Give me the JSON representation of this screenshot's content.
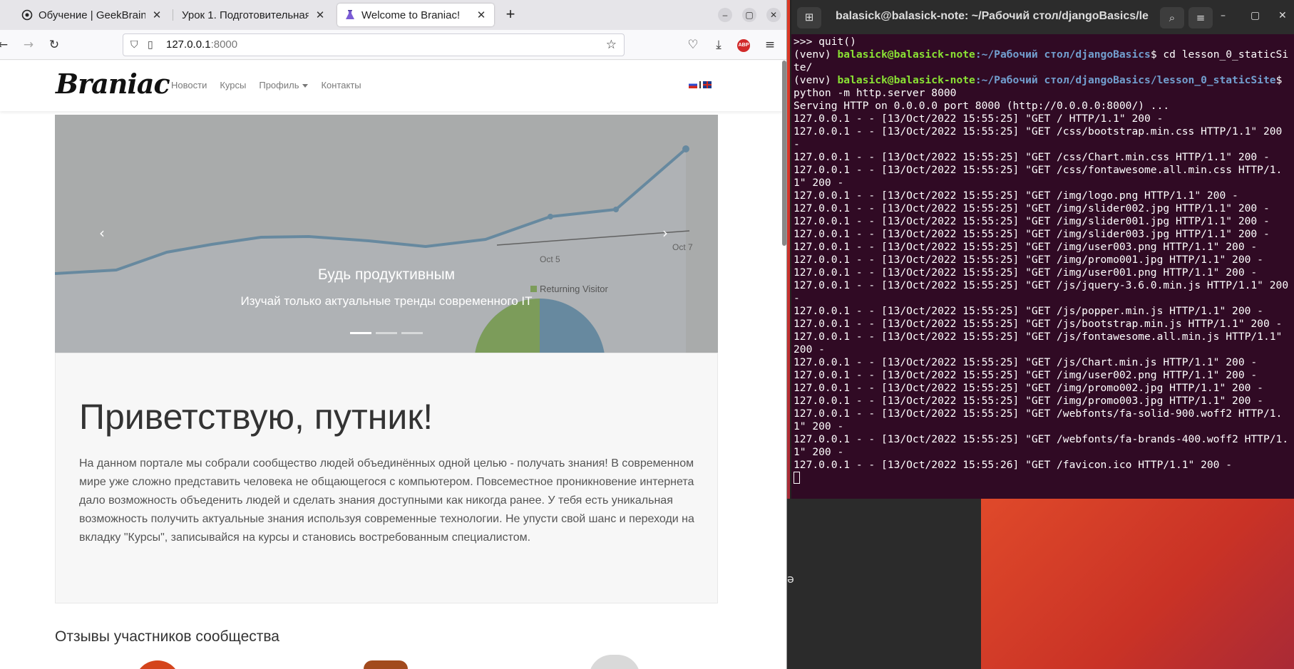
{
  "firefox": {
    "tabs": [
      {
        "label": "Обучение | GeekBrains -",
        "icon": "geekbrains-icon"
      },
      {
        "label": "Урок 1. Подготовительная",
        "icon": "none"
      },
      {
        "label": "Welcome to Braniac!",
        "icon": "flask-icon",
        "active": true
      }
    ],
    "url_host": "127.0.0.1",
    "url_port": ":8000"
  },
  "site": {
    "logo": "Braniac",
    "menu": [
      "Новости",
      "Курсы",
      "Профиль",
      "Контакты"
    ],
    "carousel": {
      "title": "Будь продуктивным",
      "subtitle": "Изучай только актуальные тренды современного IT",
      "slides": 3,
      "active_slide": 1
    },
    "hero_title": "Приветствую, путник!",
    "hero_text": "На данном портале мы собрали сообщество людей объединённых одной целью - получать знания! В современном мире уже сложно представить человека не общающегося с компьютером. Повсеместное проникновение интернета дало возможность объеденить людей и сделать знания доступными как никогда ранее. У тебя есть уникальная возможность получить актуальные знания используя современные технологии. Не упусти свой шанс и переходи на вкладку \"Курсы\", записывайся на курсы и становись востребованным специалистом.",
    "reviews_title": "Отзывы участников сообщества"
  },
  "terminal": {
    "title": "balasick@balasick-note: ~/Рабочий стол/djangoBasics/le...",
    "prompt_user": "balasick@balasick-note",
    "lines": [
      {
        "t": ">>> quit()"
      },
      {
        "venv": "(venv) ",
        "user": "balasick@balasick-note",
        "path": ":~/Рабочий стол/djangoBasics",
        "cmd": "$ cd lesson_0_staticSite/"
      },
      {
        "venv": "(venv) ",
        "user": "balasick@balasick-note",
        "path": ":~/Рабочий стол/djangoBasics/lesson_0_staticSite",
        "cmd": "$ python -m http.server 8000"
      },
      {
        "t": "Serving HTTP on 0.0.0.0 port 8000 (http://0.0.0.0:8000/) ..."
      },
      {
        "t": "127.0.0.1 - - [13/Oct/2022 15:55:25] \"GET / HTTP/1.1\" 200 -"
      },
      {
        "t": "127.0.0.1 - - [13/Oct/2022 15:55:25] \"GET /css/bootstrap.min.css HTTP/1.1\" 200 -"
      },
      {
        "t": "127.0.0.1 - - [13/Oct/2022 15:55:25] \"GET /css/Chart.min.css HTTP/1.1\" 200 -"
      },
      {
        "t": "127.0.0.1 - - [13/Oct/2022 15:55:25] \"GET /css/fontawesome.all.min.css HTTP/1.1\" 200 -"
      },
      {
        "t": "127.0.0.1 - - [13/Oct/2022 15:55:25] \"GET /img/logo.png HTTP/1.1\" 200 -"
      },
      {
        "t": "127.0.0.1 - - [13/Oct/2022 15:55:25] \"GET /img/slider002.jpg HTTP/1.1\" 200 -"
      },
      {
        "t": "127.0.0.1 - - [13/Oct/2022 15:55:25] \"GET /img/slider001.jpg HTTP/1.1\" 200 -"
      },
      {
        "t": "127.0.0.1 - - [13/Oct/2022 15:55:25] \"GET /img/slider003.jpg HTTP/1.1\" 200 -"
      },
      {
        "t": "127.0.0.1 - - [13/Oct/2022 15:55:25] \"GET /img/user003.png HTTP/1.1\" 200 -"
      },
      {
        "t": "127.0.0.1 - - [13/Oct/2022 15:55:25] \"GET /img/promo001.jpg HTTP/1.1\" 200 -"
      },
      {
        "t": "127.0.0.1 - - [13/Oct/2022 15:55:25] \"GET /img/user001.png HTTP/1.1\" 200 -"
      },
      {
        "t": "127.0.0.1 - - [13/Oct/2022 15:55:25] \"GET /js/jquery-3.6.0.min.js HTTP/1.1\" 200 -"
      },
      {
        "t": "127.0.0.1 - - [13/Oct/2022 15:55:25] \"GET /js/popper.min.js HTTP/1.1\" 200 -"
      },
      {
        "t": "127.0.0.1 - - [13/Oct/2022 15:55:25] \"GET /js/bootstrap.min.js HTTP/1.1\" 200 -"
      },
      {
        "t": "127.0.0.1 - - [13/Oct/2022 15:55:25] \"GET /js/fontawesome.all.min.js HTTP/1.1\" 200 -"
      },
      {
        "t": "127.0.0.1 - - [13/Oct/2022 15:55:25] \"GET /js/Chart.min.js HTTP/1.1\" 200 -"
      },
      {
        "t": "127.0.0.1 - - [13/Oct/2022 15:55:25] \"GET /img/user002.png HTTP/1.1\" 200 -"
      },
      {
        "t": "127.0.0.1 - - [13/Oct/2022 15:55:25] \"GET /img/promo002.jpg HTTP/1.1\" 200 -"
      },
      {
        "t": "127.0.0.1 - - [13/Oct/2022 15:55:25] \"GET /img/promo003.jpg HTTP/1.1\" 200 -"
      },
      {
        "t": "127.0.0.1 - - [13/Oct/2022 15:55:25] \"GET /webfonts/fa-solid-900.woff2 HTTP/1.1\" 200 -"
      },
      {
        "t": "127.0.0.1 - - [13/Oct/2022 15:55:25] \"GET /webfonts/fa-brands-400.woff2 HTTP/1.1\" 200 -"
      },
      {
        "t": "127.0.0.1 - - [13/Oct/2022 15:55:26] \"GET /favicon.ico HTTP/1.1\" 200 -"
      }
    ]
  }
}
